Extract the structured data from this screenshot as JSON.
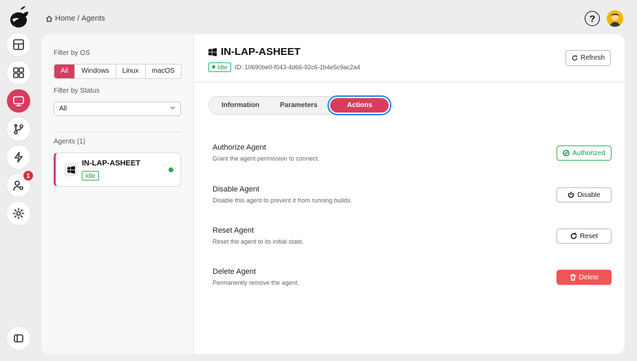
{
  "breadcrumb": {
    "home": "Home",
    "separator": "/",
    "current": "Agents"
  },
  "topbar": {
    "help": "?"
  },
  "sidebar": {
    "notification_count": "1"
  },
  "filters": {
    "os_label": "Filter by OS",
    "os_options": [
      "All",
      "Windows",
      "Linux",
      "macOS"
    ],
    "status_label": "Filter by Status",
    "status_value": "All",
    "agents_heading": "Agents (1)"
  },
  "agent_list": [
    {
      "name": "IN-LAP-ASHEET",
      "status": "Idle"
    }
  ],
  "detail": {
    "title": "IN-LAP-ASHEET",
    "status": "Idle",
    "id": "ID: 10690be0-f043-4d66-92c6-1b4e5c9ac2a4",
    "refresh_label": "Refresh",
    "tabs": [
      "Information",
      "Parameters",
      "Actions"
    ],
    "actions": [
      {
        "title": "Authorize Agent",
        "desc": "Grant the agent permission to connect.",
        "button": "Authorized"
      },
      {
        "title": "Disable Agent",
        "desc": "Disable this agent to prevent it from running builds.",
        "button": "Disable"
      },
      {
        "title": "Reset Agent",
        "desc": "Reset the agent to its initial state.",
        "button": "Reset"
      },
      {
        "title": "Delete Agent",
        "desc": "Permanently remove the agent.",
        "button": "Delete"
      }
    ]
  },
  "colors": {
    "accent": "#d93c5f",
    "success": "#2db35d",
    "danger": "#f25555",
    "focus": "#1e88e5"
  }
}
